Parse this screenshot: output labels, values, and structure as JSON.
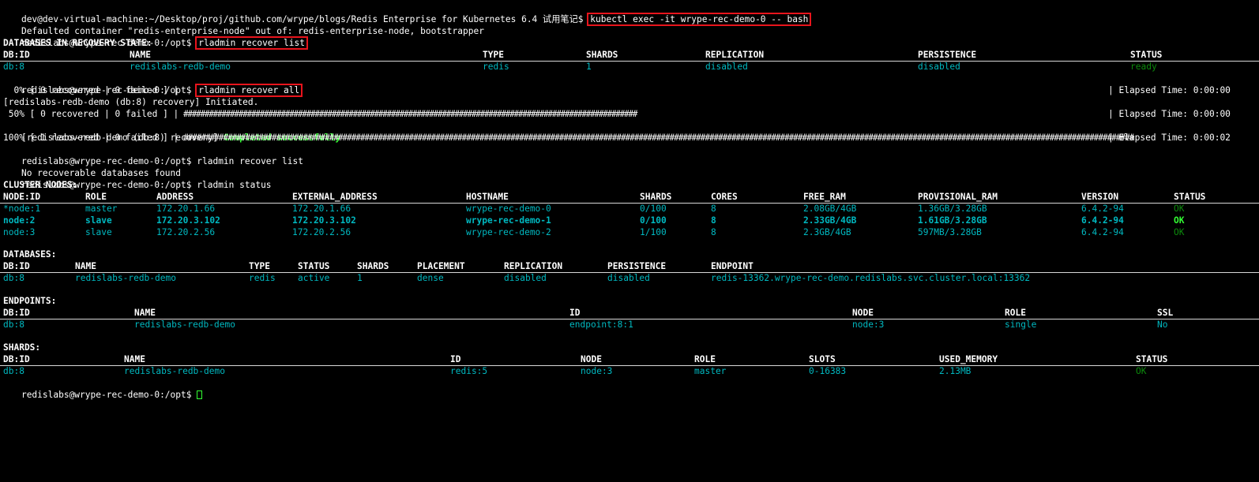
{
  "cmd": {
    "l1_prompt": "dev@dev-virtual-machine:~/Desktop/proj/github.com/wrype/blogs/Redis Enterprise for Kubernetes 6.4 试用笔记$",
    "l1_cmd": "kubectl exec -it wrype-rec-demo-0 -- bash",
    "l2": "Defaulted container \"redis-enterprise-node\" out of: redis-enterprise-node, bootstrapper",
    "prompt": "redislabs@wrype-rec-demo-0:/opt$",
    "cmd_list": "rladmin recover list",
    "cmd_all": "rladmin recover all",
    "cmd_status": "rladmin status"
  },
  "recovery": {
    "title": "DATABASES IN RECOVERY STATE:",
    "headers": [
      "DB:ID",
      "NAME",
      "TYPE",
      "SHARDS",
      "REPLICATION",
      "PERSISTENCE",
      "STATUS"
    ],
    "row": [
      "db:8",
      "redislabs-redb-demo",
      "redis",
      "1",
      "disabled",
      "disabled",
      "ready"
    ]
  },
  "progress": {
    "p0_status": "  0% [ 0 recovered | 0 failed ] |",
    "elapsed0": "| Elapsed Time: 0:00:00",
    "initiated": "[redislabs-redb-demo (db:8) recovery] Initiated.",
    "p50_status": " 50% [ 0 recovered | 0 failed ] |",
    "p50_bar": "###########################################################################################################",
    "elapsed50": "| Elapsed Time: 0:00:00",
    "completed_prefix": "[redislabs-redb-demo (db:8) recovery]",
    "completed_msg": "Completed successfully",
    "p100_status": "100% [ 1 recovered | 0 failed ] |",
    "p100_bar": "#######################################################################################################################################################################################################################",
    "elapsed100": "| Elapsed Time: 0:00:02"
  },
  "recover_list_result": "No recoverable databases found",
  "cluster": {
    "title": "CLUSTER NODES:",
    "headers": [
      "NODE:ID",
      "ROLE",
      "ADDRESS",
      "EXTERNAL_ADDRESS",
      "HOSTNAME",
      "SHARDS",
      "CORES",
      "FREE_RAM",
      "PROVISIONAL_RAM",
      "VERSION",
      "STATUS"
    ],
    "rows": [
      [
        "*node:1",
        "master",
        "172.20.1.66",
        "172.20.1.66",
        "wrype-rec-demo-0",
        "0/100",
        "8",
        "2.08GB/4GB",
        "1.36GB/3.28GB",
        "6.4.2-94",
        "OK"
      ],
      [
        "node:2",
        "slave",
        "172.20.3.102",
        "172.20.3.102",
        "wrype-rec-demo-1",
        "0/100",
        "8",
        "2.33GB/4GB",
        "1.61GB/3.28GB",
        "6.4.2-94",
        "OK"
      ],
      [
        "node:3",
        "slave",
        "172.20.2.56",
        "172.20.2.56",
        "wrype-rec-demo-2",
        "1/100",
        "8",
        "2.3GB/4GB",
        "597MB/3.28GB",
        "6.4.2-94",
        "OK"
      ]
    ]
  },
  "databases": {
    "title": "DATABASES:",
    "headers": [
      "DB:ID",
      "NAME",
      "TYPE",
      "STATUS",
      "SHARDS",
      "PLACEMENT",
      "REPLICATION",
      "PERSISTENCE",
      "ENDPOINT"
    ],
    "row": [
      "db:8",
      "redislabs-redb-demo",
      "redis",
      "active",
      "1",
      "dense",
      "disabled",
      "disabled",
      "redis-13362.wrype-rec-demo.redislabs.svc.cluster.local:13362"
    ]
  },
  "endpoints": {
    "title": "ENDPOINTS:",
    "headers": [
      "DB:ID",
      "NAME",
      "ID",
      "NODE",
      "ROLE",
      "SSL"
    ],
    "row": [
      "db:8",
      "redislabs-redb-demo",
      "endpoint:8:1",
      "node:3",
      "single",
      "No"
    ]
  },
  "shards": {
    "title": "SHARDS:",
    "headers": [
      "DB:ID",
      "NAME",
      "ID",
      "NODE",
      "ROLE",
      "SLOTS",
      "USED_MEMORY",
      "STATUS"
    ],
    "row": [
      "db:8",
      "redislabs-redb-demo",
      "redis:5",
      "node:3",
      "master",
      "0-16383",
      "2.13MB",
      "OK"
    ]
  },
  "colors": {
    "background": "#000000",
    "text": "#ffffff",
    "cyan": "#00b8c0",
    "green_dim": "#0c8a0c",
    "green_bright": "#33ff33",
    "highlight_box": "#e8141c"
  }
}
